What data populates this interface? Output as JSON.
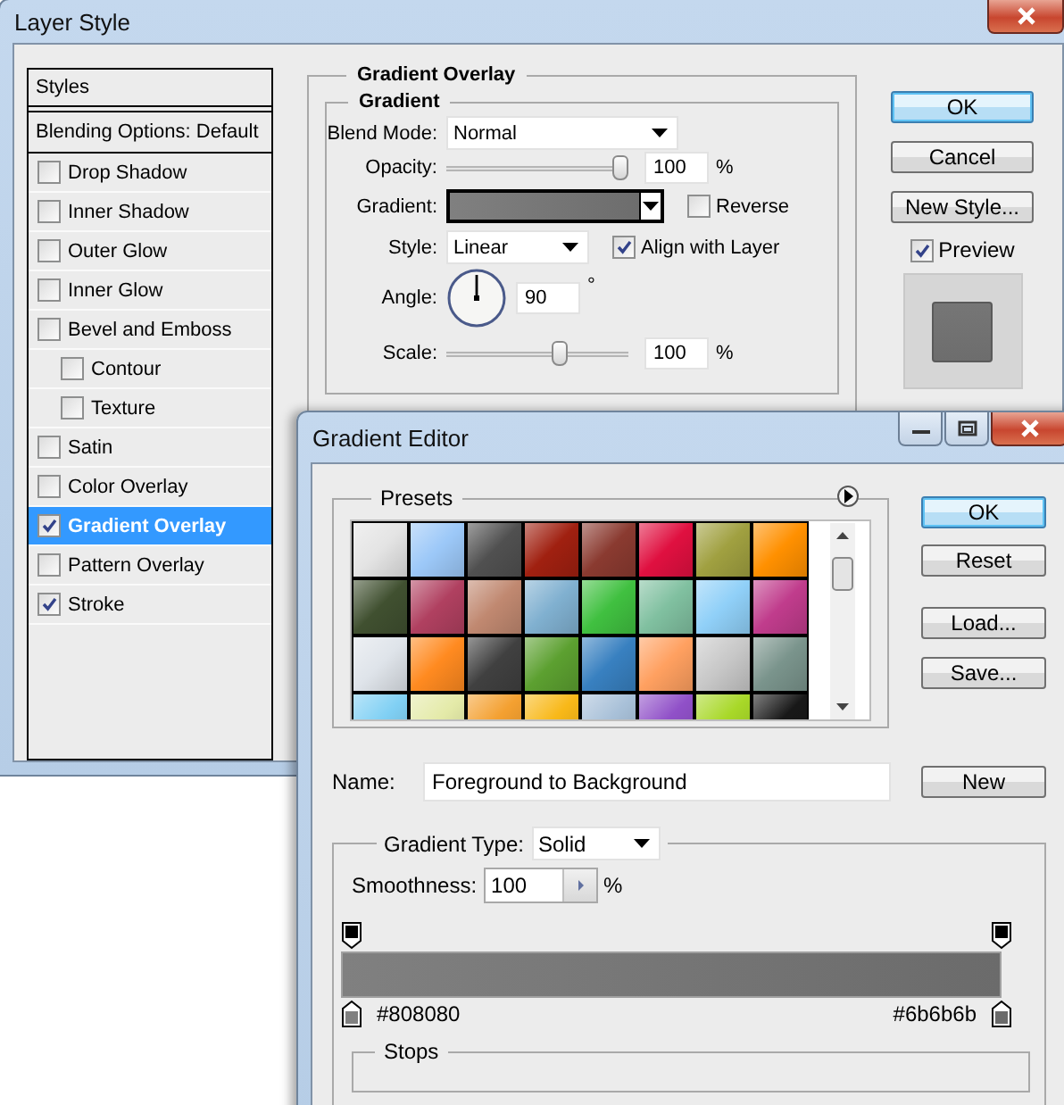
{
  "layer_style": {
    "title": "Layer Style",
    "styles_header": "Styles",
    "blending_options": "Blending Options: Default",
    "effects": [
      {
        "label": "Drop Shadow",
        "checked": false,
        "selected": false
      },
      {
        "label": "Inner Shadow",
        "checked": false,
        "selected": false
      },
      {
        "label": "Outer Glow",
        "checked": false,
        "selected": false
      },
      {
        "label": "Inner Glow",
        "checked": false,
        "selected": false
      },
      {
        "label": "Bevel and Emboss",
        "checked": false,
        "selected": false,
        "children": [
          {
            "label": "Contour",
            "checked": false,
            "selected": false
          },
          {
            "label": "Texture",
            "checked": false,
            "selected": false
          }
        ]
      },
      {
        "label": "Satin",
        "checked": false,
        "selected": false
      },
      {
        "label": "Color Overlay",
        "checked": false,
        "selected": false
      },
      {
        "label": "Gradient Overlay",
        "checked": true,
        "selected": true
      },
      {
        "label": "Pattern Overlay",
        "checked": false,
        "selected": false
      },
      {
        "label": "Stroke",
        "checked": true,
        "selected": false
      }
    ],
    "group_title": "Gradient Overlay",
    "subgroup_title": "Gradient",
    "blend_mode": {
      "label": "Blend Mode:",
      "value": "Normal"
    },
    "opacity": {
      "label": "Opacity:",
      "level": 1,
      "value": "100",
      "unit": "%"
    },
    "gradient": {
      "label": "Gradient:"
    },
    "reverse": {
      "label": "Reverse",
      "checked": false
    },
    "style": {
      "label": "Style:",
      "value": "Linear"
    },
    "align_with_layer": {
      "label": "Align with Layer",
      "checked": true
    },
    "angle": {
      "label": "Angle:",
      "value": "90",
      "unit": "°"
    },
    "scale": {
      "label": "Scale:",
      "level": 0.63,
      "value": "100",
      "unit": "%"
    },
    "buttons": [
      {
        "label": "OK",
        "default": true
      },
      {
        "label": "Cancel",
        "default": false
      },
      {
        "label": "New Style...",
        "default": false
      }
    ],
    "preview": {
      "label": "Preview",
      "checked": true
    }
  },
  "gradient_editor": {
    "title": "Gradient Editor",
    "presets": {
      "label": "Presets",
      "swatches": [
        {
          "color": "#e4e4e4"
        },
        {
          "color": "#9cc8f8"
        },
        {
          "color": "#505050"
        },
        {
          "color": "#a02010"
        },
        {
          "color": "#8a3a30"
        },
        {
          "color": "#e01040"
        },
        {
          "color": "#a0a040"
        },
        {
          "color": "#ff9000"
        },
        {
          "color": "#405030"
        },
        {
          "color": "#b04060"
        },
        {
          "color": "#c08870"
        },
        {
          "color": "#80b0d0"
        },
        {
          "color": "#40c040"
        },
        {
          "color": "#80c0a0"
        },
        {
          "color": "#90d0f8"
        },
        {
          "color": "#c03c8c"
        },
        {
          "color": "#dfe4ea"
        },
        {
          "color": "#ff8a20"
        },
        {
          "color": "#404040"
        },
        {
          "color": "#5ca030"
        },
        {
          "color": "#3880c0"
        },
        {
          "color": "#ffa060"
        },
        {
          "color": "#c8c8c8"
        },
        {
          "color": "#7a948c"
        },
        {
          "color": "#80d0f4"
        },
        {
          "color": "#e4eaa8"
        },
        {
          "color": "#f4a030"
        },
        {
          "color": "#f8b818"
        },
        {
          "color": "#a8c0d8"
        },
        {
          "color": "#9050c8"
        },
        {
          "color": "#a8d828"
        },
        {
          "color": "#181818"
        }
      ]
    },
    "buttons": [
      {
        "label": "OK",
        "default": true
      },
      {
        "label": "Reset",
        "default": false
      },
      {
        "label": "Load...",
        "default": false
      },
      {
        "label": "Save...",
        "default": false
      }
    ],
    "name": {
      "label": "Name:",
      "value": "Foreground to Background"
    },
    "new_button": "New",
    "gradient_type": {
      "label": "Gradient Type:",
      "value": "Solid"
    },
    "smoothness": {
      "label": "Smoothness:",
      "value": "100",
      "unit": "%"
    },
    "opacity_stops": [
      {
        "color": "#000000"
      },
      {
        "color": "#000000"
      }
    ],
    "color_stops": [
      {
        "color": "#808080",
        "label": "#808080"
      },
      {
        "color": "#6b6b6b",
        "label": "#6b6b6b"
      }
    ],
    "stops_title": "Stops"
  }
}
